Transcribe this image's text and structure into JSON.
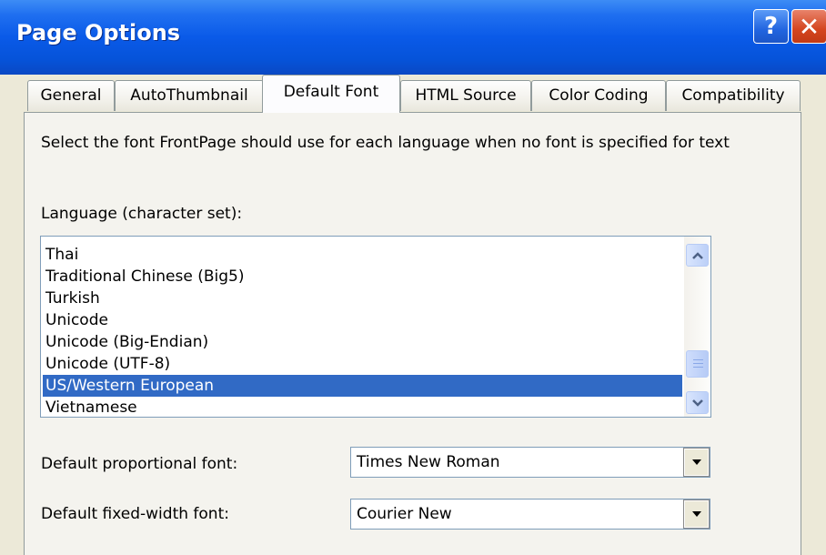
{
  "window": {
    "title": "Page Options",
    "help_glyph": "?",
    "close_glyph": "✕",
    "title_bar_color": "#0a5ae8"
  },
  "tabs": [
    {
      "label": "General",
      "active": false
    },
    {
      "label": "AutoThumbnail",
      "active": false
    },
    {
      "label": "Default Font",
      "active": true
    },
    {
      "label": "HTML Source",
      "active": false
    },
    {
      "label": "Color Coding",
      "active": false
    },
    {
      "label": "Compatibility",
      "active": false
    }
  ],
  "default_font": {
    "description": "Select the font FrontPage should use for each language when no font is specified for text",
    "language_label": "Language (character set):",
    "languages": [
      "Thai",
      "Traditional Chinese (Big5)",
      "Turkish",
      "Unicode",
      "Unicode (Big-Endian)",
      "Unicode (UTF-8)",
      "US/Western European",
      "Vietnamese"
    ],
    "selected_language": "US/Western European",
    "selection_color": "#316ac5",
    "proportional_label": "Default proportional font:",
    "proportional_value": "Times New Roman",
    "fixed_label": "Default fixed-width font:",
    "fixed_value": "Courier New"
  }
}
